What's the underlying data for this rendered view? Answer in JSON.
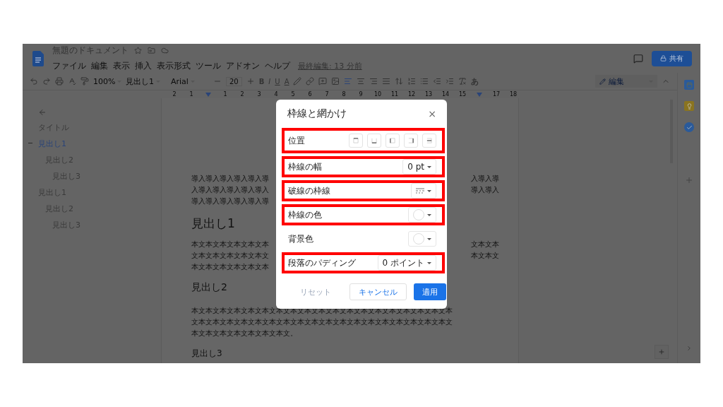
{
  "window": {
    "title": "無題のドキュメント",
    "last_edit": "最終編集: 13 分前",
    "share": "共有"
  },
  "menu": [
    "ファイル",
    "編集",
    "表示",
    "挿入",
    "表示形式",
    "ツール",
    "アドオン",
    "ヘルプ"
  ],
  "toolbar": {
    "zoom": "100%",
    "style": "見出し1",
    "font": "Arial",
    "font_size": "20",
    "bold": "B",
    "italic": "I",
    "underline": "U",
    "text_color": "A",
    "input_tool": "あ",
    "mode": "編集"
  },
  "ruler": [
    {
      "kind": "number",
      "text": "2"
    },
    {
      "kind": "number",
      "text": "1"
    },
    {
      "kind": "marker"
    },
    {
      "kind": "number",
      "text": "1"
    },
    {
      "kind": "number",
      "text": "2"
    },
    {
      "kind": "number",
      "text": "3"
    },
    {
      "kind": "number",
      "text": "4"
    },
    {
      "kind": "number",
      "text": "5"
    },
    {
      "kind": "number",
      "text": "6"
    },
    {
      "kind": "number",
      "text": "7"
    },
    {
      "kind": "number",
      "text": "8"
    },
    {
      "kind": "number",
      "text": "9"
    },
    {
      "kind": "number",
      "text": "10"
    },
    {
      "kind": "number",
      "text": "11"
    },
    {
      "kind": "number",
      "text": "12"
    },
    {
      "kind": "number",
      "text": "13"
    },
    {
      "kind": "number",
      "text": "14"
    },
    {
      "kind": "number",
      "text": "15"
    },
    {
      "kind": "marker"
    },
    {
      "kind": "number",
      "text": "17"
    },
    {
      "kind": "number",
      "text": "18"
    }
  ],
  "outline": [
    {
      "label": "タイトル",
      "selected": false
    },
    {
      "label": "見出し1",
      "selected": true,
      "children": [
        {
          "label": "見出し2",
          "selected": false,
          "children": [
            {
              "label": "見出し3",
              "selected": false
            }
          ]
        }
      ]
    },
    {
      "label": "見出し1",
      "selected": false,
      "children": [
        {
          "label": "見出し2",
          "selected": false,
          "children": [
            {
              "label": "見出し3",
              "selected": false
            }
          ]
        }
      ]
    }
  ],
  "document": [
    {
      "kind": "para",
      "lines": [
        {
          "left": "導入導入導入導入導入導",
          "right": "入導入導"
        },
        {
          "left": "入導入導入導入導入導入",
          "right": "導入導入"
        },
        {
          "left": "導入導入導入導入導入導"
        }
      ]
    },
    {
      "kind": "h1",
      "text": "見出し1"
    },
    {
      "kind": "para",
      "lines": [
        {
          "left": "本文本文本文本文本文本",
          "right": "文本文本"
        },
        {
          "left": "文本文本文本文本文本文",
          "right": "本文本文"
        },
        {
          "left": "本文本文本文本文本文本"
        }
      ]
    },
    {
      "kind": "h2",
      "text": "見出し2"
    },
    {
      "kind": "para",
      "lines": [
        {
          "left": "本文本文本文本文本文本文本文本文本文本文本文本文本文本文本文本文本文本文本"
        },
        {
          "left": "文本文本文本文本文本文本文本文本文本文本文本文本文本文本文本文本文本文本文"
        },
        {
          "left": "本文本文本文本文本文本文本文。"
        }
      ]
    },
    {
      "kind": "h3",
      "text": "見出し3"
    }
  ],
  "dialog": {
    "title": "枠線と網かけ",
    "close": "×",
    "rows": [
      {
        "kind": "positions",
        "label": "位置",
        "highlighted": true
      },
      {
        "kind": "dropdown",
        "label": "枠線の幅",
        "value": "0 pt",
        "highlighted": true
      },
      {
        "kind": "dash",
        "label": "破線の枠線",
        "highlighted": true
      },
      {
        "kind": "color",
        "label": "枠線の色",
        "highlighted": true
      },
      {
        "kind": "color",
        "label": "背景色",
        "highlighted": false
      },
      {
        "kind": "dropdown",
        "label": "段落のパディング",
        "value": "0 ポイント",
        "highlighted": true
      }
    ],
    "buttons": [
      {
        "label": "リセット",
        "kind": "text",
        "disabled": true
      },
      {
        "label": "キャンセル",
        "kind": "outline",
        "disabled": false
      },
      {
        "label": "適用",
        "kind": "primary",
        "disabled": false
      }
    ]
  }
}
